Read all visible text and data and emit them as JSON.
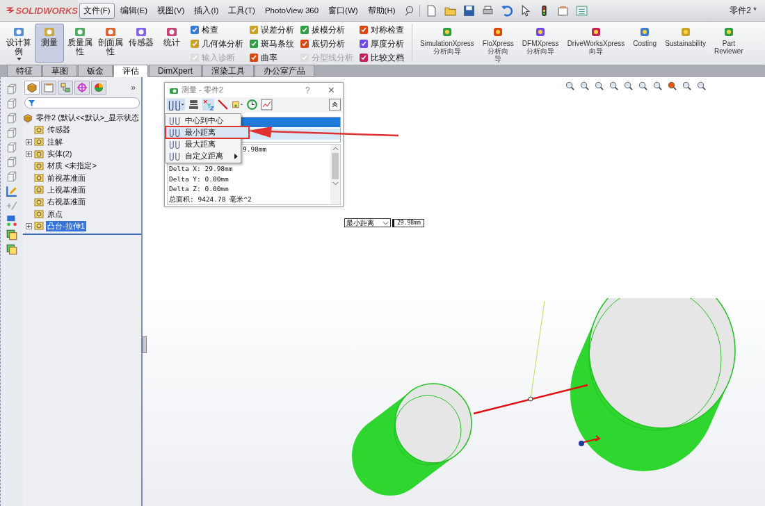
{
  "app": {
    "logo": "SOLIDWORKS",
    "document_title": "零件2 *"
  },
  "menu": [
    {
      "label": "文件(F)",
      "selected": true
    },
    {
      "label": "编辑(E)",
      "selected": false
    },
    {
      "label": "视图(V)",
      "selected": false
    },
    {
      "label": "插入(I)",
      "selected": false
    },
    {
      "label": "工具(T)",
      "selected": false
    },
    {
      "label": "PhotoView 360",
      "selected": false
    },
    {
      "label": "窗口(W)",
      "selected": false
    },
    {
      "label": "帮助(H)",
      "selected": false
    }
  ],
  "ribbon": {
    "large_tools": [
      {
        "label": "设计算例",
        "kind": "dropdown",
        "selected": false
      },
      {
        "label": "测量",
        "kind": "button",
        "selected": true
      },
      {
        "label": "质量属性",
        "kind": "button",
        "selected": false
      },
      {
        "label": "剖面属性",
        "kind": "button",
        "selected": false
      },
      {
        "label": "传感器",
        "kind": "button",
        "selected": false
      },
      {
        "label": "统计",
        "kind": "button",
        "selected": false
      }
    ],
    "small_tool_columns": [
      [
        {
          "label": "检查",
          "disabled": false
        },
        {
          "label": "几何体分析",
          "disabled": false
        },
        {
          "label": "输入诊断",
          "disabled": true
        }
      ],
      [
        {
          "label": "误差分析",
          "disabled": false
        },
        {
          "label": "斑马条纹",
          "disabled": false
        },
        {
          "label": "曲率",
          "disabled": false
        }
      ],
      [
        {
          "label": "拔模分析",
          "disabled": false
        },
        {
          "label": "底切分析",
          "disabled": false
        },
        {
          "label": "分型线分析",
          "disabled": true
        }
      ],
      [
        {
          "label": "对称检查",
          "disabled": false
        },
        {
          "label": "厚度分析",
          "disabled": false
        },
        {
          "label": "比较文档",
          "disabled": false
        }
      ]
    ],
    "xpress_tools": [
      {
        "lines": [
          "SimulationXpress",
          "分析向导"
        ]
      },
      {
        "lines": [
          "FloXpress",
          "分析向",
          "导"
        ]
      },
      {
        "lines": [
          "DFMXpress",
          "分析向导"
        ]
      },
      {
        "lines": [
          "DriveWorksXpress",
          "向导"
        ]
      },
      {
        "lines": [
          "Costing"
        ]
      },
      {
        "lines": [
          "Sustainability"
        ]
      },
      {
        "lines": [
          "Part",
          "Reviewer"
        ]
      }
    ]
  },
  "command_tabs": [
    {
      "label": "特征",
      "selected": false
    },
    {
      "label": "草图",
      "selected": false
    },
    {
      "label": "钣金",
      "selected": false
    },
    {
      "label": "评估",
      "selected": true
    },
    {
      "label": "DimXpert",
      "selected": false
    },
    {
      "label": "渲染工具",
      "selected": false
    },
    {
      "label": "办公室产品",
      "selected": false
    }
  ],
  "feature_tree": {
    "more": "»",
    "root": {
      "label": "零件2  (默认<<默认>_显示状态",
      "children": [
        {
          "label": "传感器",
          "collapsed": false,
          "selected": false
        },
        {
          "label": "注解",
          "collapsed": true,
          "selected": false
        },
        {
          "label": "实体(2)",
          "collapsed": true,
          "selected": false
        },
        {
          "label": "材质 <未指定>",
          "collapsed": false,
          "selected": false
        },
        {
          "label": "前视基准面",
          "collapsed": false,
          "selected": false
        },
        {
          "label": "上视基准面",
          "collapsed": false,
          "selected": false
        },
        {
          "label": "右视基准面",
          "collapsed": false,
          "selected": false
        },
        {
          "label": "原点",
          "collapsed": false,
          "selected": false
        },
        {
          "label": "凸台-拉伸1",
          "collapsed": true,
          "selected": true
        }
      ]
    }
  },
  "measure_dialog": {
    "title": "测量 - 零件2",
    "help": "?",
    "close": "×",
    "menu": [
      {
        "label": "中心到中心",
        "selected": false,
        "submenu": false
      },
      {
        "label": "最小距离",
        "selected": true,
        "submenu": false
      },
      {
        "label": "最大距离",
        "selected": false,
        "submenu": false
      },
      {
        "label": "自定义距离",
        "selected": false,
        "submenu": true
      }
    ],
    "results": [
      "9.98mm",
      "Delta X: 29.98mm",
      "Delta Y: 0.00mm",
      "Delta Z: 0.00mm",
      "总面积: 9424.78 毫米^2"
    ]
  },
  "callout": {
    "mode": "最小距离",
    "value": "29.98mm"
  }
}
